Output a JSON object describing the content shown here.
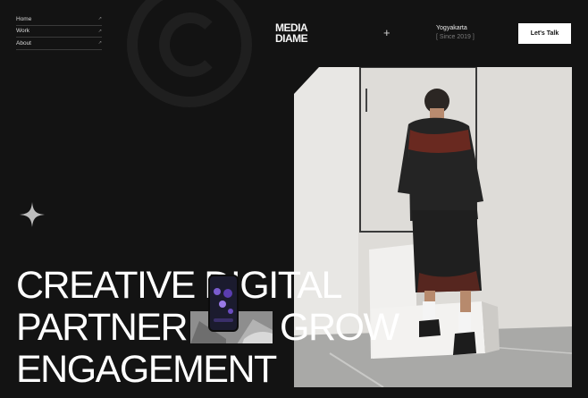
{
  "nav": {
    "items": [
      {
        "label": "Home",
        "arrow": "↗"
      },
      {
        "label": "Work",
        "arrow": "↗"
      },
      {
        "label": "About",
        "arrow": "↗"
      }
    ]
  },
  "logo": {
    "line1": "MEDIA",
    "line2": "DIAME"
  },
  "location": {
    "city": "Yogyakarta",
    "since": "[ Since 2019 ]"
  },
  "cta": {
    "label": "Let's Talk"
  },
  "headline": {
    "line1": "CREATIVE DIGITAL",
    "line2_part1": "PARTNER",
    "line2_part2": "GROW",
    "line3": "ENGAGEMENT"
  },
  "icons": [
    "copyright-icon",
    "plus-icon",
    "sparkle-icon",
    "arrow-up-right-icon"
  ],
  "colors": {
    "background": "#131313",
    "text": "#ffffff",
    "cta_bg": "#ffffff",
    "cta_text": "#111111"
  }
}
